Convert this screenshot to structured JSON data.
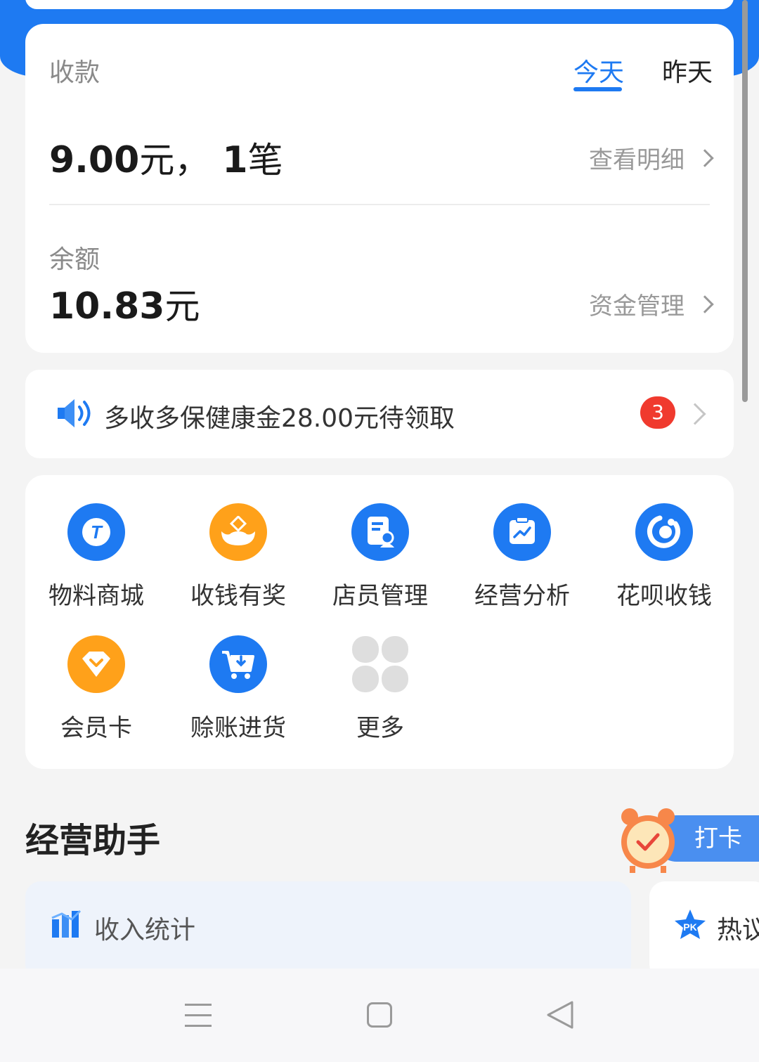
{
  "summary": {
    "title": "收款",
    "tabs": [
      "今天",
      "昨天"
    ],
    "amount": "9.00",
    "amount_unit": "元，",
    "count": "1",
    "count_unit": "笔",
    "detail_link": "查看明细",
    "balance_label": "余额",
    "balance": "10.83",
    "balance_unit": "元",
    "fund_link": "资金管理"
  },
  "notice": {
    "text": "多收多保健康金28.00元待领取",
    "badge": "3"
  },
  "tools": [
    {
      "label": "物料商城",
      "icon": "t-shop-icon",
      "color": "#1e7af2"
    },
    {
      "label": "收钱有奖",
      "icon": "ingot-icon",
      "color": "#ffa11a"
    },
    {
      "label": "店员管理",
      "icon": "staff-doc-icon",
      "color": "#1e7af2"
    },
    {
      "label": "经营分析",
      "icon": "chart-icon",
      "color": "#1e7af2"
    },
    {
      "label": "花呗收钱",
      "icon": "huabei-icon",
      "color": "#1e7af2"
    },
    {
      "label": "会员卡",
      "icon": "diamond-icon",
      "color": "#ffa11a"
    },
    {
      "label": "赊账进货",
      "icon": "cart-icon",
      "color": "#1e7af2"
    },
    {
      "label": "更多",
      "icon": "more-grid-icon",
      "color": "#dcdcdc"
    }
  ],
  "assistant": {
    "title": "经营助手",
    "checkin": "打卡",
    "stat_card_title": "收入统计",
    "hot_card_title": "热议"
  }
}
